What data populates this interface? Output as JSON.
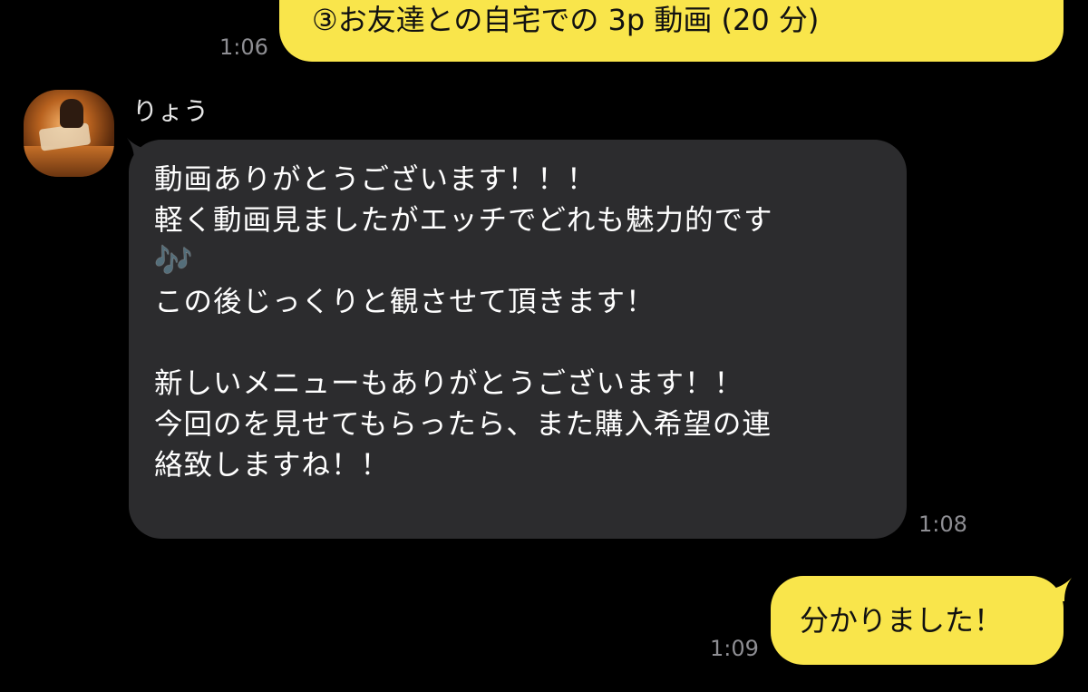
{
  "colors": {
    "background": "#000000",
    "outgoing_bubble": "#f9e54b",
    "incoming_bubble": "#2c2c2e",
    "timestamp": "#8e8e93"
  },
  "messages": {
    "top_outgoing": {
      "text": "③お友達との自宅での 3p 動画 (20 分)",
      "time": "1:06"
    },
    "incoming": {
      "sender": "りょう",
      "avatar_icon": "profile-photo",
      "lines": [
        "動画ありがとうございます！！！",
        "軽く動画見ましたがエッチでどれも魅力的です",
        "🎶",
        "この後じっくりと観させて頂きます！",
        "",
        "新しいメニューもありがとうございます！！",
        "今回のを見せてもらったら、また購入希望の連",
        "絡致しますね！！"
      ],
      "time": "1:08"
    },
    "bottom_outgoing": {
      "text": "分かりました！",
      "time": "1:09"
    }
  }
}
